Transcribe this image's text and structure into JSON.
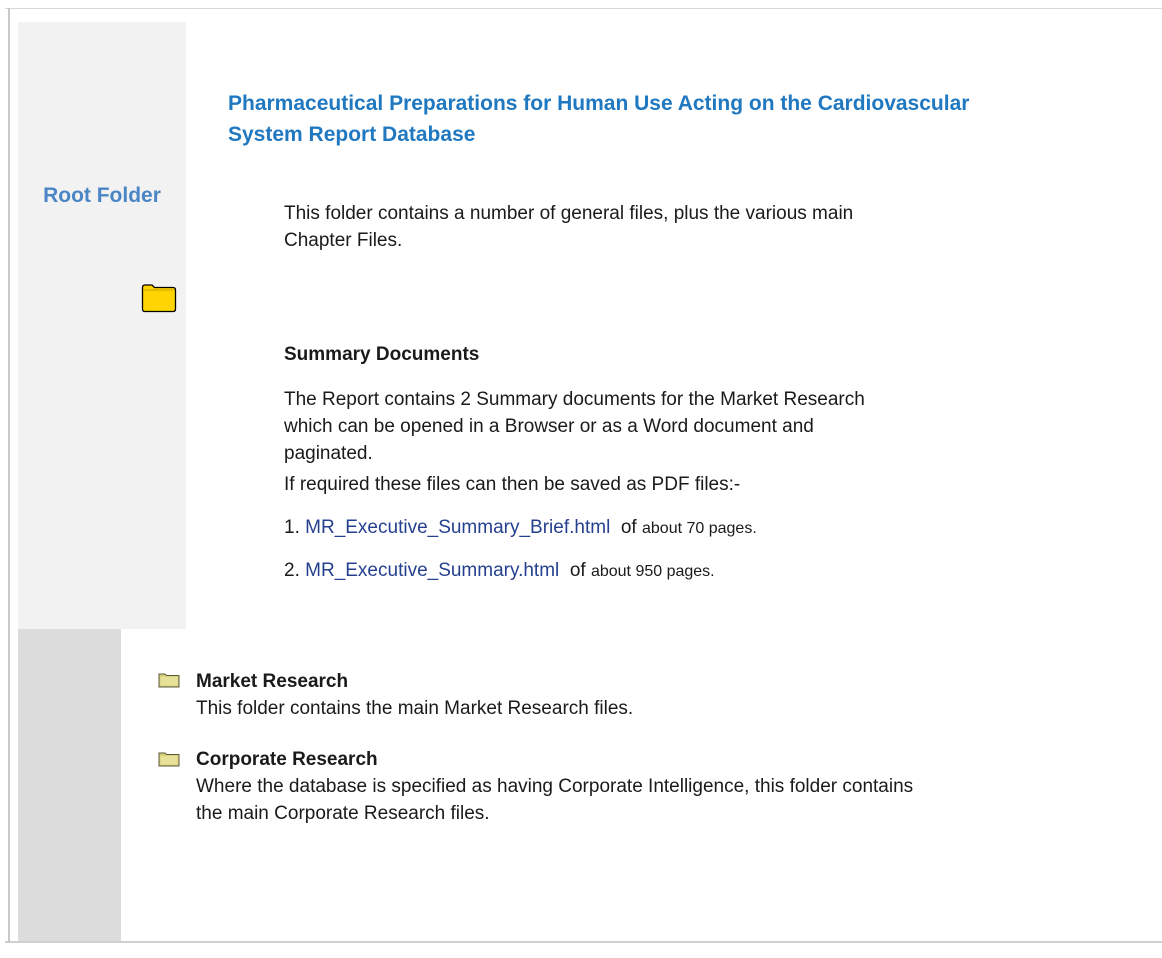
{
  "sidebar": {
    "root_label": "Root Folder"
  },
  "main": {
    "title": "Pharmaceutical Preparations for Human Use Acting on the Cardiovascular System Report Database",
    "intro": "This folder contains a number of general files, plus the various main Chapter Files.",
    "summary_heading": "Summary Documents",
    "summary_text": "The Report contains 2 Summary documents for the Market Research which can be opened in a Browser or as a Word document and paginated.",
    "pdf_note": "If required these files can then be saved as PDF files:-",
    "files": [
      {
        "number": "1.",
        "link": "MR_Executive_Summary_Brief.html",
        "of_text": "of",
        "about_text": "about 70 pages."
      },
      {
        "number": "2.",
        "link": "MR_Executive_Summary.html",
        "of_text": "of",
        "about_text": "about 950 pages."
      }
    ]
  },
  "folders": [
    {
      "name": "Market Research",
      "description": "This folder contains the main Market Research files."
    },
    {
      "name": "Corporate Research",
      "description": "Where the database is specified as having Corporate Intelligence, this folder contains the main Corporate Research files."
    }
  ],
  "colors": {
    "title": "#1f78c0",
    "root_label": "#4a86c5",
    "link": "#25408f",
    "folder_yellow": "#ffd700",
    "small_folder": "#d8cf6e"
  },
  "icons": {
    "root": "folder-icon",
    "folder": "folder-icon"
  }
}
